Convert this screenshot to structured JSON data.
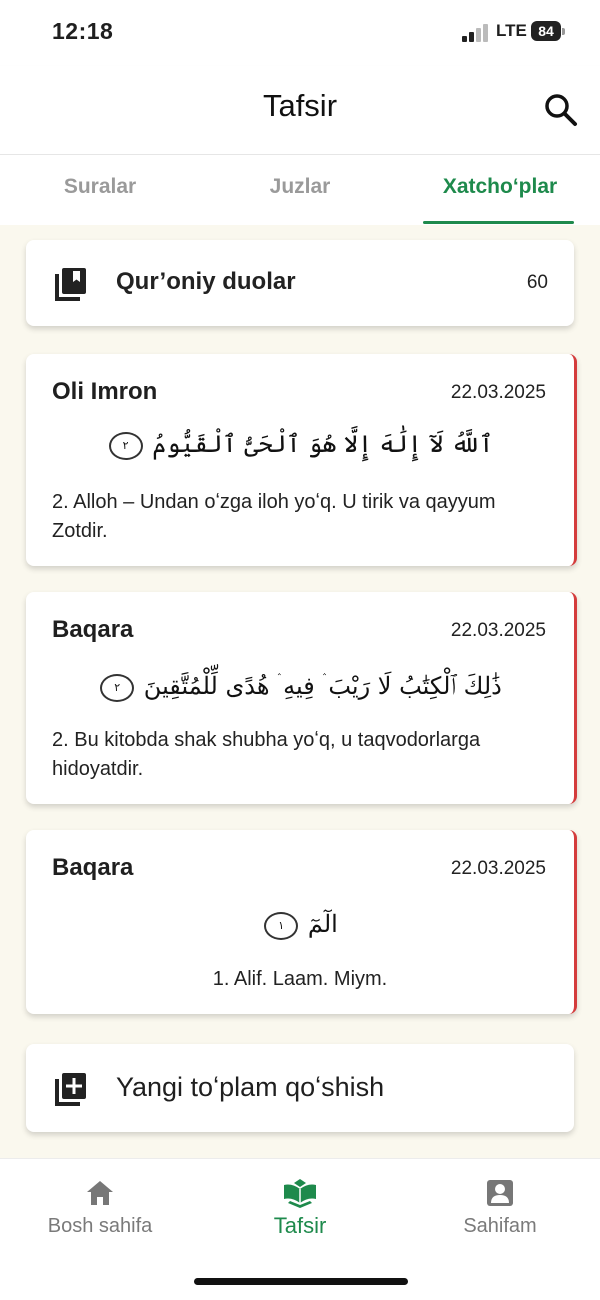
{
  "status_bar": {
    "time": "12:18",
    "network": "LTE",
    "battery": "84"
  },
  "header": {
    "title": "Tafsir",
    "search_icon": "search-icon"
  },
  "tabs": [
    {
      "label": "Suralar",
      "active": false
    },
    {
      "label": "Juzlar",
      "active": false
    },
    {
      "label": "Xatchoʻplar",
      "active": true
    }
  ],
  "colors": {
    "accent": "#1e8a4c",
    "bookmark_border": "#d43c3c",
    "background": "#faf8ee"
  },
  "folder": {
    "icon": "library-books-icon",
    "label": "Qur’oniy duolar",
    "count": "60"
  },
  "bookmarks": [
    {
      "surah": "Oli Imron",
      "date": "22.03.2025",
      "arabic": "ٱللَّهُ لَآ إِلَٰهَ إِلَّا هُوَ ٱلْحَىُّ ٱلْقَيُّومُ",
      "verse_marker": "٢",
      "translation": "2. Alloh – Undan oʻzga iloh yoʻq. U tirik va qayyum Zotdir."
    },
    {
      "surah": "Baqara",
      "date": "22.03.2025",
      "arabic": "ذَٰلِكَ ٱلْكِتَٰبُ لَا رَيْبَ ۛ فِيهِ ۛ هُدًى لِّلْمُتَّقِينَ",
      "verse_marker": "٢",
      "translation": "2. Bu kitobda shak shubha yoʻq, u taqvodorlarga hidoyatdir."
    },
    {
      "surah": "Baqara",
      "date": "22.03.2025",
      "arabic": "الٓمٓ",
      "verse_marker": "١",
      "translation": "1. Alif. Laam. Miym."
    }
  ],
  "add_collection": {
    "icon": "library-add-icon",
    "label": "Yangi toʻplam qoʻshish"
  },
  "bottom_nav": [
    {
      "label": "Bosh sahifa",
      "icon": "home-icon",
      "active": false
    },
    {
      "label": "Tafsir",
      "icon": "quran-book-icon",
      "active": true
    },
    {
      "label": "Sahifam",
      "icon": "account-box-icon",
      "active": false
    }
  ]
}
